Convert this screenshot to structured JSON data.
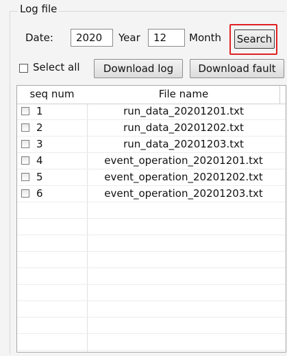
{
  "log_group": {
    "title": "Log file"
  },
  "filter": {
    "date_label": "Date:",
    "year_value": "2020",
    "year_label": "Year",
    "month_value": "12",
    "month_label": "Month",
    "search_label": "Search"
  },
  "actions": {
    "select_all_label": "Select all",
    "download_log_label": "Download log",
    "download_fault_label": "Download fault"
  },
  "table": {
    "columns": [
      "seq num",
      "File name"
    ],
    "rows": [
      {
        "seq": "1",
        "file": "run_data_20201201.txt"
      },
      {
        "seq": "2",
        "file": "run_data_20201202.txt"
      },
      {
        "seq": "3",
        "file": "run_data_20201203.txt"
      },
      {
        "seq": "4",
        "file": "event_operation_20201201.txt"
      },
      {
        "seq": "5",
        "file": "event_operation_20201202.txt"
      },
      {
        "seq": "6",
        "file": "event_operation_20201203.txt"
      }
    ],
    "empty_rows": 10
  },
  "colors": {
    "highlight": "#e02020"
  }
}
